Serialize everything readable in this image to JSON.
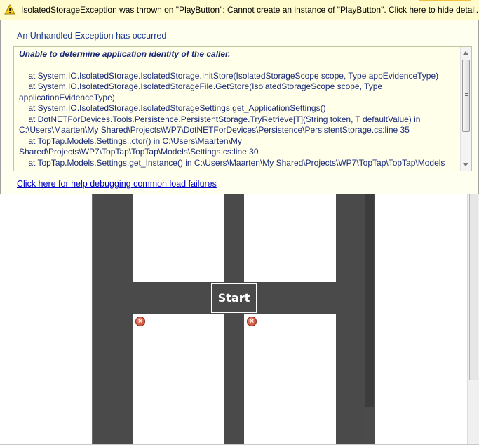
{
  "infobar": {
    "message": "IsolatedStorageException was thrown on \"PlayButton\": Cannot create an instance of \"PlayButton\". Click here to hide detail.",
    "icon": "warning-icon"
  },
  "exception": {
    "heading": "An Unhandled Exception has occurred",
    "title": "Unable to determine application identity of the caller.",
    "trace": [
      "    at System.IO.IsolatedStorage.IsolatedStorage.InitStore(IsolatedStorageScope scope, Type appEvidenceType)",
      "    at System.IO.IsolatedStorage.IsolatedStorageFile.GetStore(IsolatedStorageScope scope, Type applicationEvidenceType)",
      "    at System.IO.IsolatedStorage.IsolatedStorageSettings.get_ApplicationSettings()",
      "    at DotNETForDevices.Tools.Persistence.PersistentStorage.TryRetrieve[T](String token, T defaultValue) in C:\\Users\\Maarten\\My Shared\\Projects\\WP7\\DotNETForDevices\\Persistence\\PersistentStorage.cs:line 35",
      "    at TopTap.Models.Settings..ctor() in C:\\Users\\Maarten\\My Shared\\Projects\\WP7\\TopTap\\TopTap\\Models\\Settings.cs:line 30",
      "    at TopTap.Models.Settings.get_Instance() in C:\\Users\\Maarten\\My Shared\\Projects\\WP7\\TopTap\\TopTap\\Models"
    ],
    "help_link": "Click here for help debugging common load failures"
  },
  "designer": {
    "start_label": "Start"
  },
  "colors": {
    "infobar_bg": "#fffbcc",
    "panel_bg": "#fffff0",
    "phone_bg": "#4a4a4a",
    "link": "#0000cc"
  }
}
